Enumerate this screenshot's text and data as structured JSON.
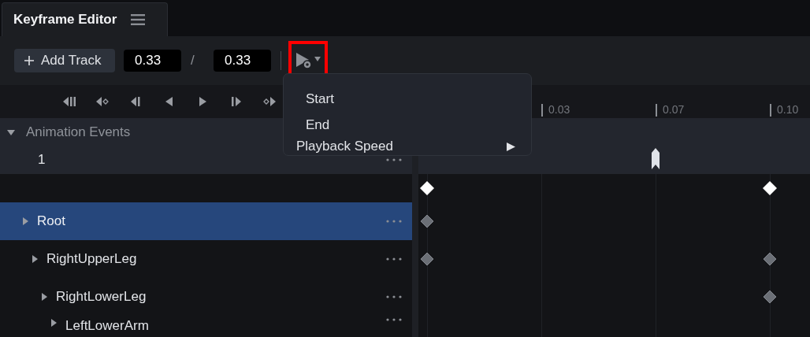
{
  "tab": {
    "title": "Keyframe Editor"
  },
  "toolbar": {
    "add_button": "Add Track",
    "current_time": "0.33",
    "separator": "/",
    "total_time": "0.33",
    "playback_button": {
      "highlighted": true
    }
  },
  "transport": [
    {
      "kind": "first"
    },
    {
      "kind": "prev-key"
    },
    {
      "kind": "prev-frame"
    },
    {
      "kind": "reverse"
    },
    {
      "kind": "play"
    },
    {
      "kind": "next-frame"
    },
    {
      "kind": "next-key"
    }
  ],
  "ruler": {
    "ticks": [
      {
        "label": "0.03"
      },
      {
        "label": "0.07"
      },
      {
        "label": "0.10"
      }
    ]
  },
  "menu": {
    "items": [
      {
        "label": "Start",
        "kind": "option"
      },
      {
        "label": "End",
        "kind": "option"
      },
      {
        "label": "Playback Speed",
        "kind": "submenu"
      }
    ]
  },
  "events": {
    "title": "Animation Events",
    "expanded": true,
    "rows": [
      {
        "name": "1",
        "markers": [
          false,
          false,
          true,
          false
        ]
      }
    ]
  },
  "summary": {
    "keys": [
      true,
      false,
      false,
      true
    ]
  },
  "tracks": [
    {
      "name": "Root",
      "selected": true,
      "expanded": false,
      "keys": [
        true,
        false,
        false,
        false
      ],
      "children": [
        {
          "name": "RightUpperLeg",
          "selected": false,
          "expanded": false,
          "keys": [
            true,
            false,
            false,
            true
          ],
          "children": [
            {
              "name": "RightLowerLeg",
              "selected": false,
              "expanded": false,
              "keys": [
                false,
                false,
                false,
                true
              ],
              "children": [
                {
                  "name": "LeftLowerArm",
                  "selected": false,
                  "expanded": false,
                  "keys": [
                    false,
                    false,
                    false,
                    false
                  ]
                }
              ]
            }
          ]
        }
      ]
    }
  ]
}
